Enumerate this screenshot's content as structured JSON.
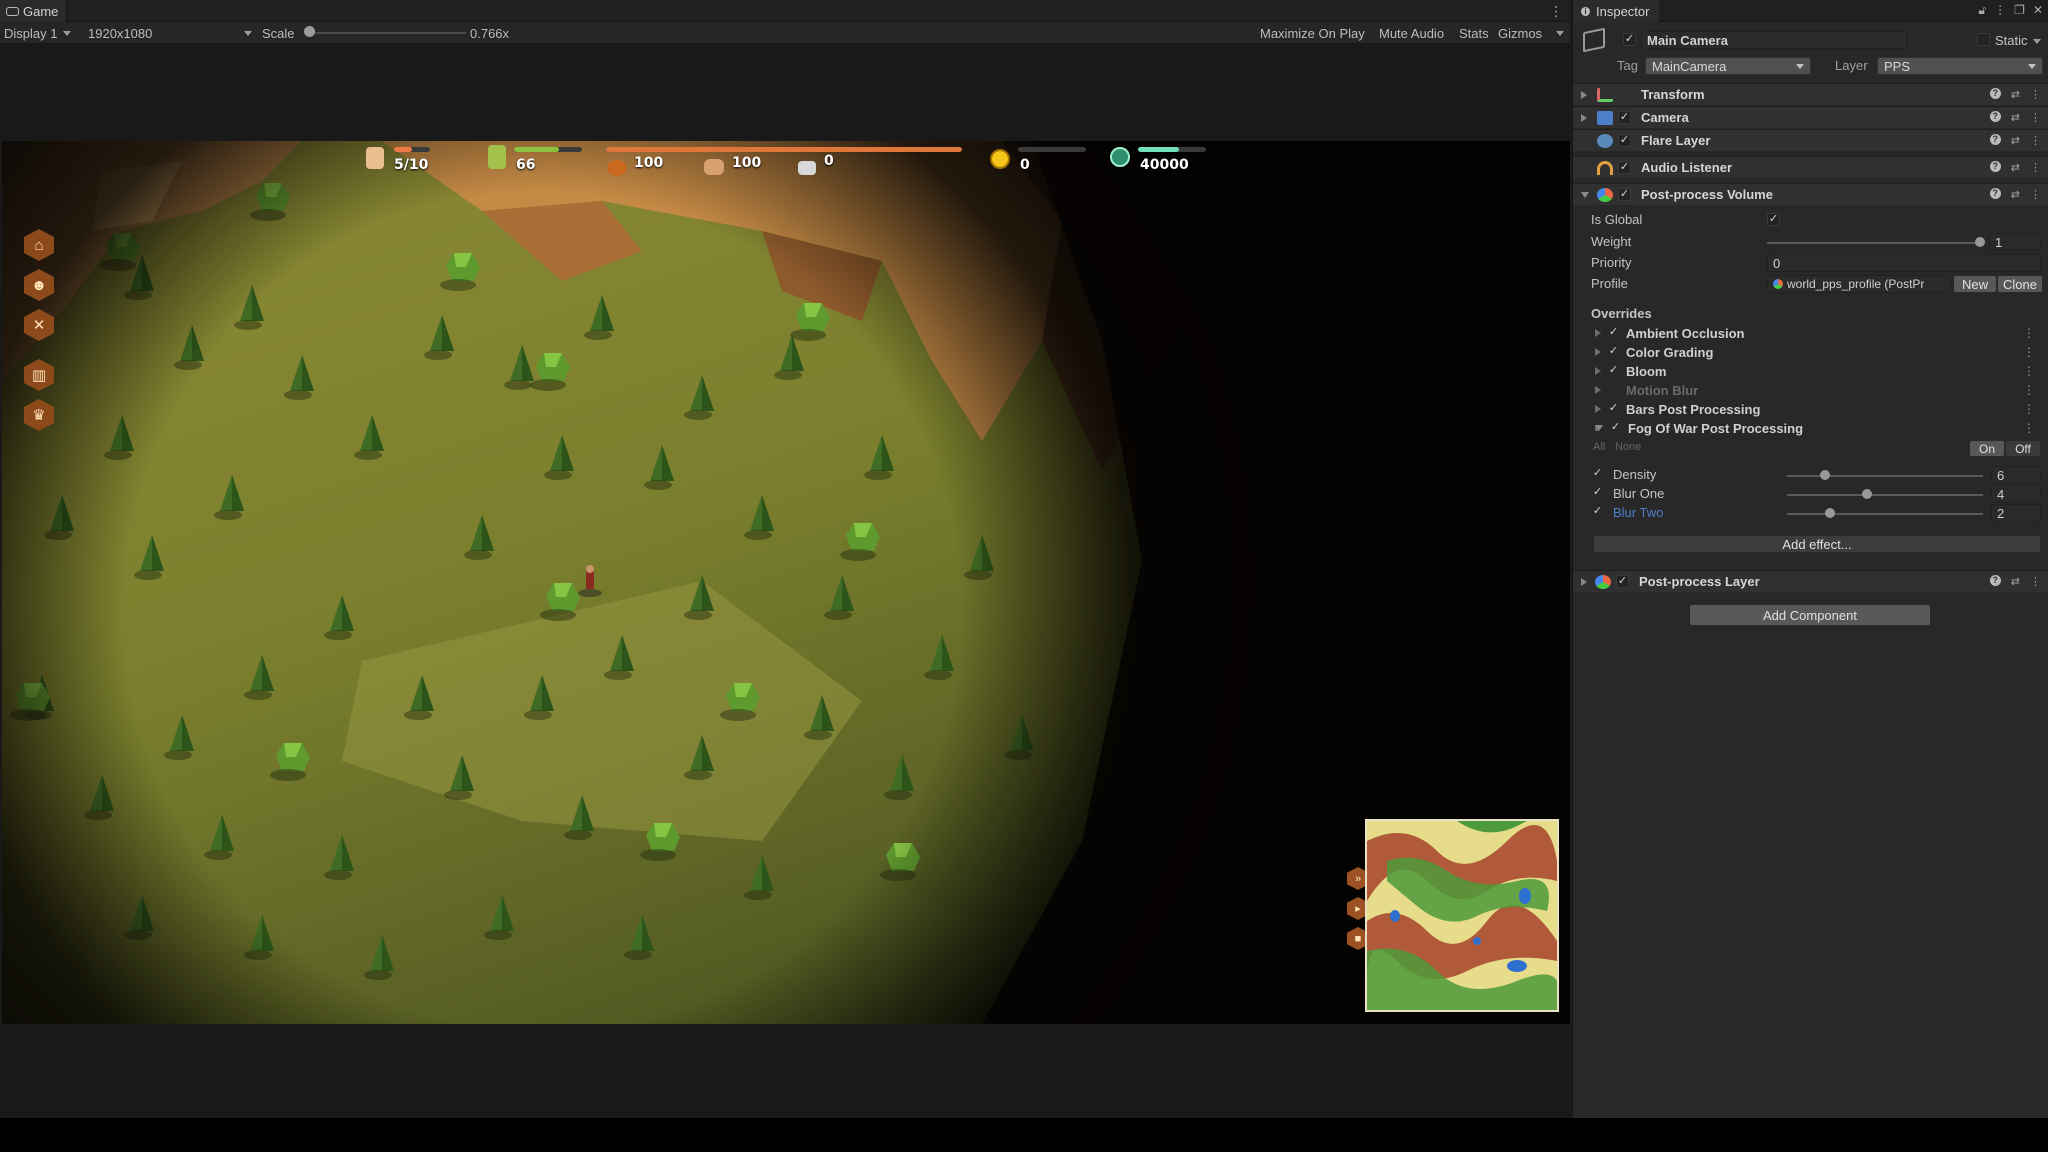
{
  "game_tab": {
    "title": "Game",
    "menu": "⋮"
  },
  "game_toolbar": {
    "display": "Display 1",
    "resolution": "1920x1080",
    "scale_label": "Scale",
    "scale_value": "0.766x",
    "maximize": "Maximize On Play",
    "mute": "Mute Audio",
    "stats": "Stats",
    "gizmos": "Gizmos"
  },
  "hud": {
    "population": "5/10",
    "population_level": 0.5,
    "food": "66",
    "food_level": 0.66,
    "wood": "100",
    "timber": "100",
    "stone": "0",
    "resource_level": 1.0,
    "gold": "0",
    "gold_level": 0.0,
    "gems": "40000",
    "gems_level": 0.6
  },
  "side_menu": [
    "house-icon",
    "worker-icon",
    "tools-icon",
    "building-icon",
    "trophy-icon"
  ],
  "minimap_buttons": [
    "fast-forward-icon",
    "play-icon",
    "pause-icon"
  ],
  "inspector": {
    "tab_title": "Inspector",
    "object_name": "Main Camera",
    "static_label": "Static",
    "tag_label": "Tag",
    "tag_value": "MainCamera",
    "layer_label": "Layer",
    "layer_value": "PPS",
    "components": {
      "transform": "Transform",
      "camera": "Camera",
      "flare": "Flare Layer",
      "audio": "Audio Listener",
      "ppv": "Post-process Volume",
      "ppl": "Post-process Layer"
    },
    "ppv": {
      "is_global_label": "Is Global",
      "weight_label": "Weight",
      "weight_value": "1",
      "priority_label": "Priority",
      "priority_value": "0",
      "profile_label": "Profile",
      "profile_value": "world_pps_profile (PostPr",
      "new_label": "New",
      "clone_label": "Clone",
      "overrides_label": "Overrides",
      "overrides": {
        "ao": "Ambient Occlusion",
        "cg": "Color Grading",
        "bloom": "Bloom",
        "mb": "Motion Blur",
        "bars": "Bars Post Processing",
        "fog": "Fog Of War Post Processing"
      },
      "all_label": "All",
      "none_label": "None",
      "on_label": "On",
      "off_label": "Off",
      "density_label": "Density",
      "density_value": "6",
      "blur_one_label": "Blur One",
      "blur_one_value": "4",
      "blur_two_label": "Blur Two",
      "blur_two_value": "2",
      "add_effect": "Add effect..."
    },
    "add_component": "Add Component"
  },
  "colors": {
    "accent_blue": "#4c7fc8",
    "population_bar": "#f07a45",
    "food_bar": "#8cc23f",
    "resource_bar": "#e0773a",
    "gem_bar": "#6fe0b8",
    "gold_icon": "#f5c518"
  }
}
